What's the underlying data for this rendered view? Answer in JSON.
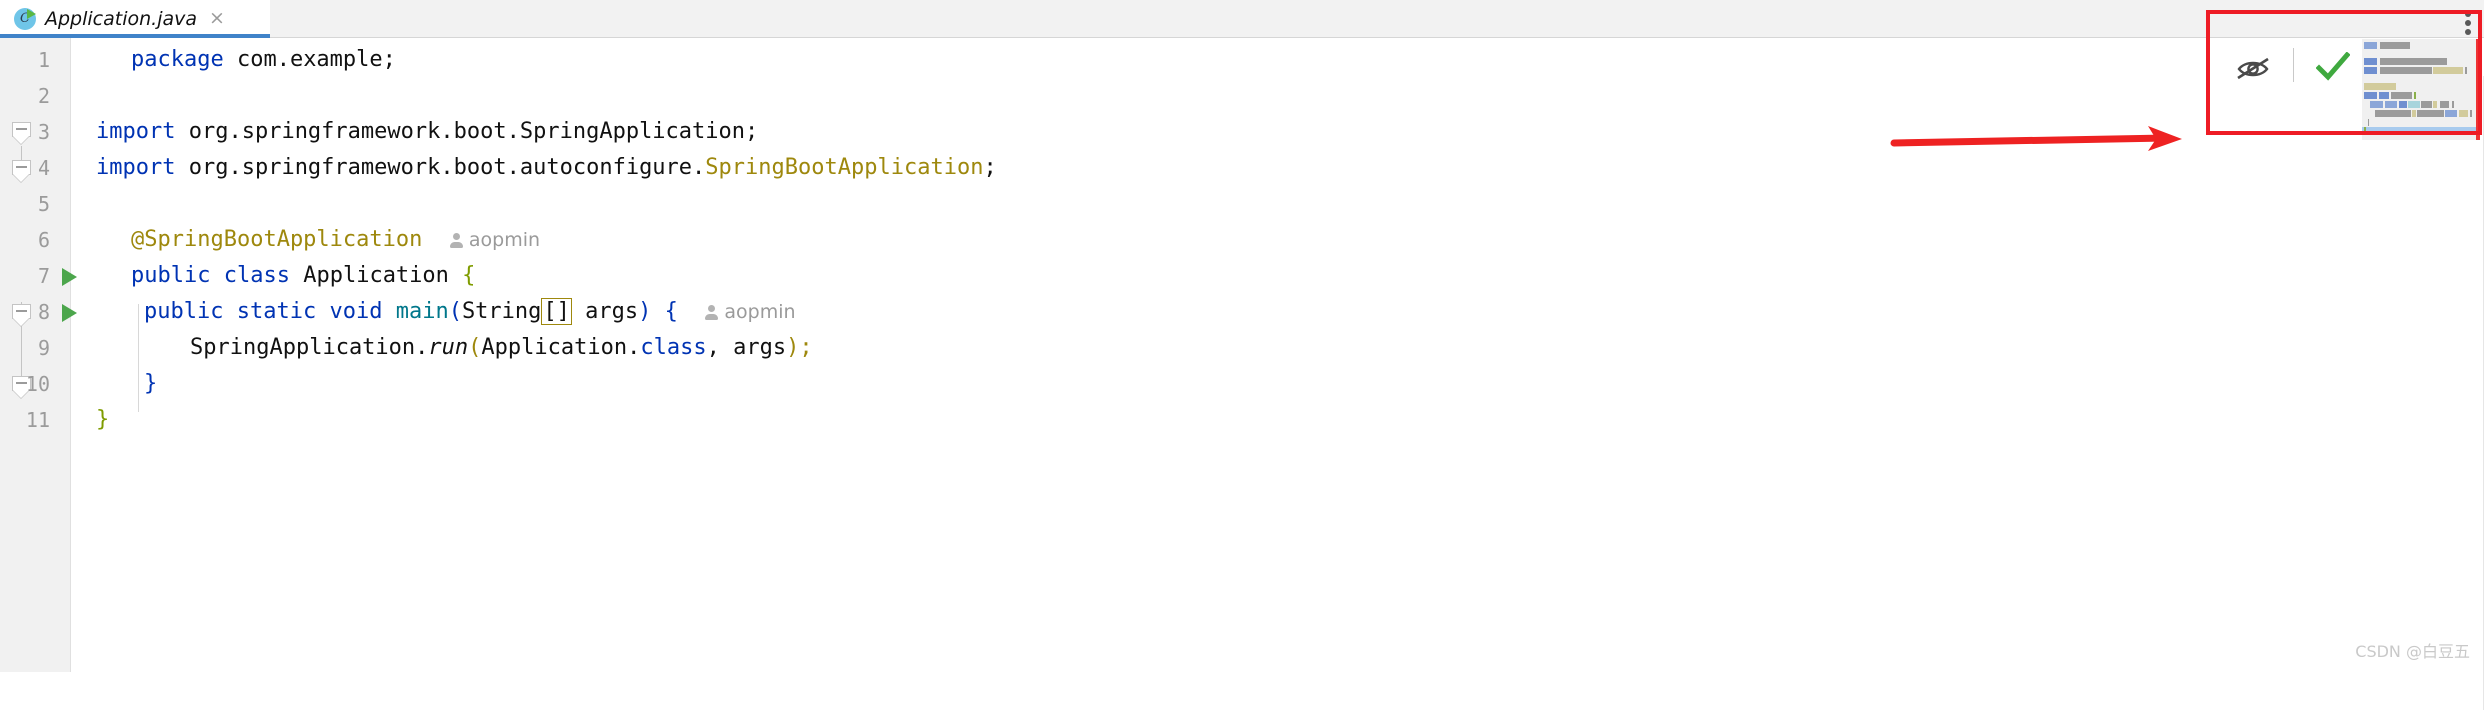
{
  "window": {
    "tab": {
      "title": "Application.java",
      "icon": "java-class-runnable-icon",
      "close_label": "×"
    }
  },
  "editor": {
    "author_label": "aopmin",
    "lines": [
      {
        "num": "1",
        "text": "package com.example;"
      },
      {
        "num": "2",
        "text": ""
      },
      {
        "num": "3",
        "text": "import org.springframework.boot.SpringApplication;"
      },
      {
        "num": "4",
        "text": "import org.springframework.boot.autoconfigure.SpringBootApplication;"
      },
      {
        "num": "5",
        "text": ""
      },
      {
        "num": "6",
        "text": "@SpringBootApplication"
      },
      {
        "num": "7",
        "text": "public class Application {"
      },
      {
        "num": "8",
        "text": "    public static void main(String[] args) {"
      },
      {
        "num": "9",
        "text": "        SpringApplication.run(Application.class, args);"
      },
      {
        "num": "10",
        "text": "    }"
      },
      {
        "num": "11",
        "text": "}"
      }
    ],
    "tokens": {
      "kw_package": "package",
      "pkg_name": " com.example;",
      "kw_import": "import",
      "import3_rest": " org.springframework.boot.SpringApplication;",
      "import4_mid": " org.springframework.boot.autoconfigure.",
      "import4_type": "SpringBootApplication",
      "semicolon": ";",
      "annotation": "@SpringBootApplication",
      "kw_public": "public",
      "kw_class": "class",
      "type_application": "Application",
      "brace_open": "{",
      "kw_static": "static",
      "kw_void": "void",
      "method_main": "main",
      "paren_open": "(",
      "type_string": "String",
      "brackets": "[]",
      "arg_args": " args",
      "paren_close": ")",
      "cls_springapplication": "SpringApplication.",
      "method_run": "run",
      "arg_application": "Application.",
      "kw_class_literal": "class",
      "comma_args": ", args",
      "stmt_end": ");",
      "brace_close_blue": "}",
      "brace_close_green": "}"
    }
  },
  "inspection_panel": {
    "hide_icon": "eye-off-icon",
    "status_icon": "green-check-icon",
    "menu_icon": "kebab-menu-icon",
    "minimap_label": "code-minimap"
  },
  "annotations": {
    "arrow": "red-arrow-pointing-right",
    "highlight_box": "red-highlight-rectangle",
    "highlight_color": "#ee1c25"
  },
  "watermark": {
    "text": "CSDN @白豆五"
  },
  "colors": {
    "keyword": "#0033b3",
    "annotation": "#9e880d",
    "method": "#00778b",
    "brace_match": "#7f9c00",
    "run_marker": "#4ca64c",
    "tab_underline": "#4083c9",
    "gutter_bg": "#f1f1f1"
  }
}
